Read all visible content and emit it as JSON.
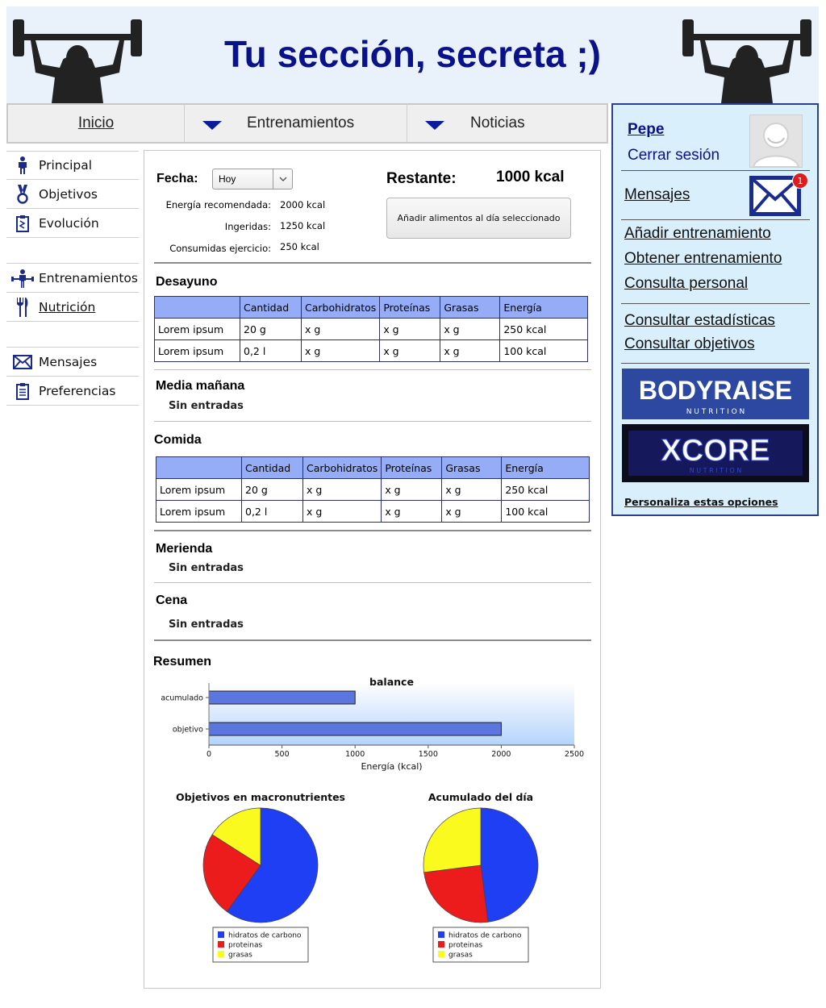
{
  "header": {
    "title": "Tu sección, secreta ;)"
  },
  "topnav": {
    "items": [
      "Inicio",
      "Entrenamientos",
      "Noticias"
    ]
  },
  "leftnav": {
    "items": [
      {
        "label": "Principal",
        "icon": "person-icon"
      },
      {
        "label": "Objetivos",
        "icon": "medal-icon"
      },
      {
        "label": "Evolución",
        "icon": "clipboard-chart-icon"
      },
      {
        "label": "Entrenamientos",
        "icon": "weightlifter-icon"
      },
      {
        "label": "Nutrición",
        "icon": "cutlery-icon"
      },
      {
        "label": "Mensajes",
        "icon": "envelope-icon"
      },
      {
        "label": "Preferencias",
        "icon": "clipboard-list-icon"
      }
    ]
  },
  "day": {
    "fecha_label": "Fecha:",
    "fecha_value": "Hoy",
    "stats": [
      {
        "label": "Energía recomendada:",
        "value": "2000 kcal"
      },
      {
        "label": "Ingeridas:",
        "value": "1250 kcal"
      },
      {
        "label": "Consumidas ejercicio:",
        "value": "250 kcal"
      }
    ],
    "restante_label": "Restante:",
    "restante_value": "1000 kcal",
    "add_button": "Añadir alimentos al día seleccionado"
  },
  "table_headers": [
    "",
    "Cantidad",
    "Carbohidratos",
    "Proteínas",
    "Grasas",
    "Energía"
  ],
  "meals": [
    {
      "title": "Desayuno",
      "rows": [
        [
          "Lorem ipsum",
          "20 g",
          "x g",
          "x g",
          "x g",
          "250 kcal"
        ],
        [
          "Lorem ipsum",
          "0,2 l",
          "x g",
          "x g",
          "x g",
          "100 kcal"
        ]
      ]
    },
    {
      "title": "Media mañana",
      "empty": "Sin entradas"
    },
    {
      "title": "Comida",
      "rows": [
        [
          "Lorem ipsum",
          "20 g",
          "x g",
          "x g",
          "x g",
          "250 kcal"
        ],
        [
          "Lorem ipsum",
          "0,2 l",
          "x g",
          "x g",
          "x g",
          "100 kcal"
        ]
      ]
    },
    {
      "title": "Merienda",
      "empty": "Sin entradas"
    },
    {
      "title": "Cena",
      "empty": "Sin entradas"
    }
  ],
  "summary": {
    "title": "Resumen"
  },
  "chart_data": [
    {
      "type": "bar",
      "orientation": "horizontal",
      "title": "balance",
      "categories": [
        "acumulado",
        "objetivo"
      ],
      "values": [
        1000,
        2000
      ],
      "xlabel": "Energía (kcal)",
      "xlim": [
        0,
        2500
      ],
      "xticks": [
        0,
        500,
        1000,
        1500,
        2000,
        2500
      ],
      "bar_color": "#5b76de"
    },
    {
      "type": "pie",
      "title": "Objetivos en macronutrientes",
      "labels": [
        "hidratos de carbono",
        "proteinas",
        "grasas"
      ],
      "values": [
        60,
        24,
        16
      ],
      "colors": [
        "#1f3ff5",
        "#ec1c1c",
        "#fafa1e"
      ],
      "legend": "bottom"
    },
    {
      "type": "pie",
      "title": "Acumulado del día",
      "labels": [
        "hidratos de carbono",
        "proteinas",
        "grasas"
      ],
      "values": [
        48,
        25,
        27
      ],
      "colors": [
        "#1f3ff5",
        "#ec1c1c",
        "#fafa1e"
      ],
      "legend": "bottom"
    }
  ],
  "rightpanel": {
    "user": "Pepe",
    "logout": "Cerrar sesión",
    "messages": "Mensajes",
    "badge": "1",
    "links1": [
      "Añadir entrenamiento",
      "Obtener entrenamiento",
      "Consulta personal"
    ],
    "links2": [
      "Consultar estadísticas",
      "Consultar objetivos"
    ],
    "banners": [
      {
        "name": "BODYRAISE",
        "sub": "N U T R I T I O N"
      },
      {
        "name": "XCORE",
        "sub": "N U T R I T I O N"
      }
    ],
    "customize": "Personaliza estas opciones"
  }
}
